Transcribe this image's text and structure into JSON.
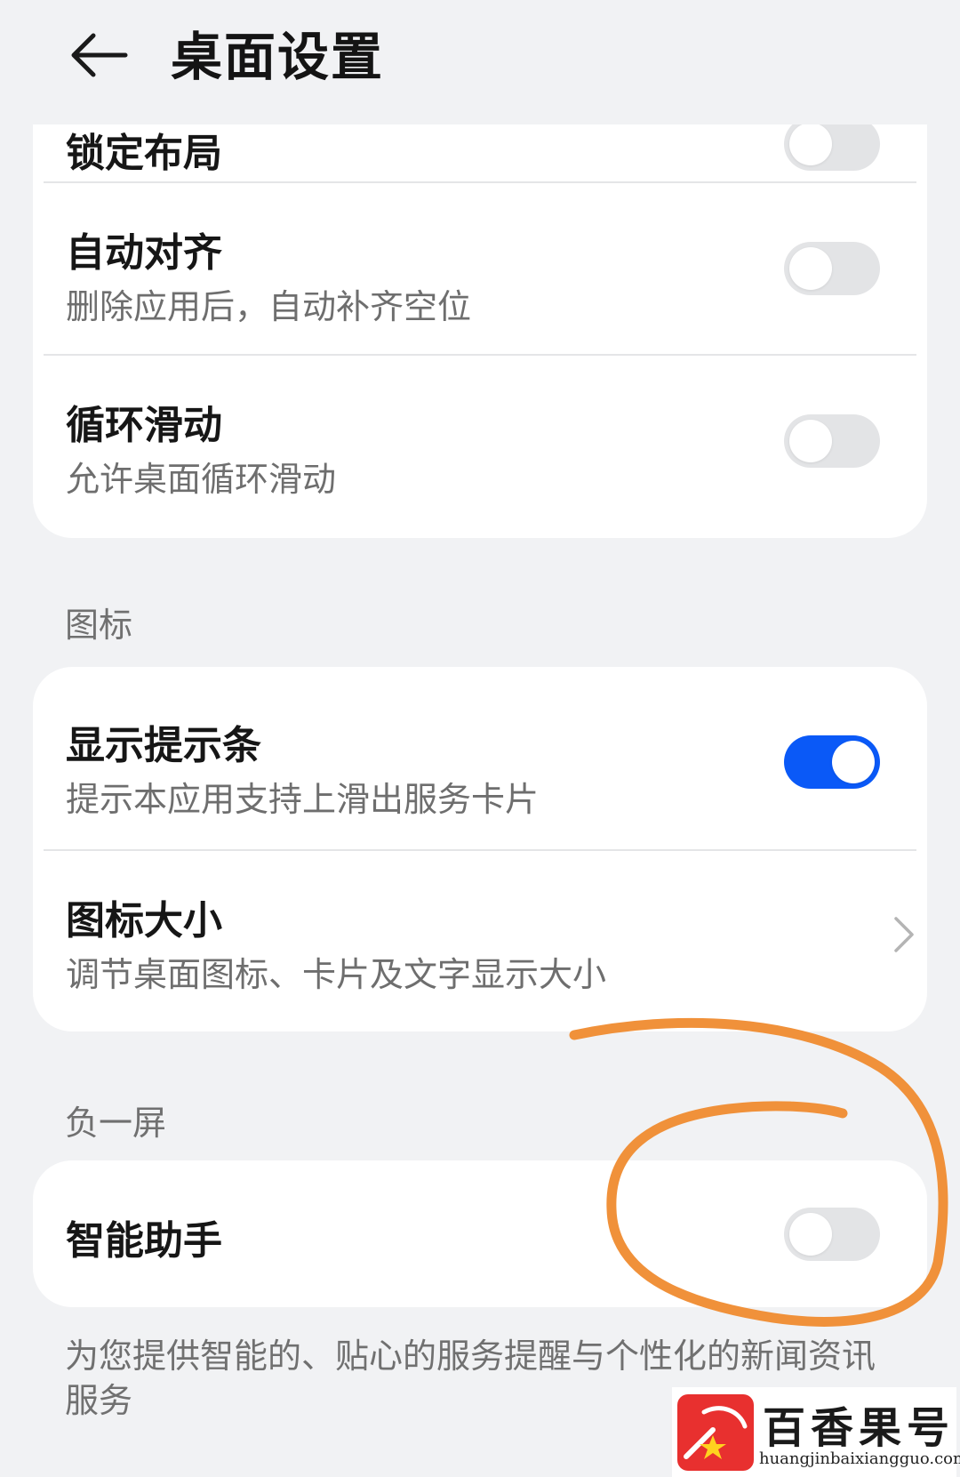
{
  "header": {
    "title": "桌面设置"
  },
  "card1": {
    "clipped_title": "锁定布局",
    "clipped_toggle_on": false,
    "items": [
      {
        "title": "自动对齐",
        "subtitle": "删除应用后，自动补齐空位",
        "toggle_on": false
      },
      {
        "title": "循环滑动",
        "subtitle": "允许桌面循环滑动",
        "toggle_on": false
      }
    ]
  },
  "section_icons": {
    "label": "图标",
    "items": [
      {
        "title": "显示提示条",
        "subtitle": "提示本应用支持上滑出服务卡片",
        "toggle_on": true
      },
      {
        "title": "图标大小",
        "subtitle": "调节桌面图标、卡片及文字显示大小"
      }
    ]
  },
  "section_minus_one": {
    "label": "负一屏",
    "items": [
      {
        "title": "智能助手",
        "toggle_on": false
      }
    ],
    "description": "为您提供智能的、贴心的服务提醒与个性化的新闻资讯服务"
  },
  "watermark": {
    "name": "百香果号",
    "url": "huangjinbaixiangguo.com"
  },
  "colors": {
    "background": "#f1f2f4",
    "card": "#ffffff",
    "accent_blue": "#0a59f7",
    "toggle_off": "#e3e4e6",
    "annotation_orange": "#f0913a"
  }
}
